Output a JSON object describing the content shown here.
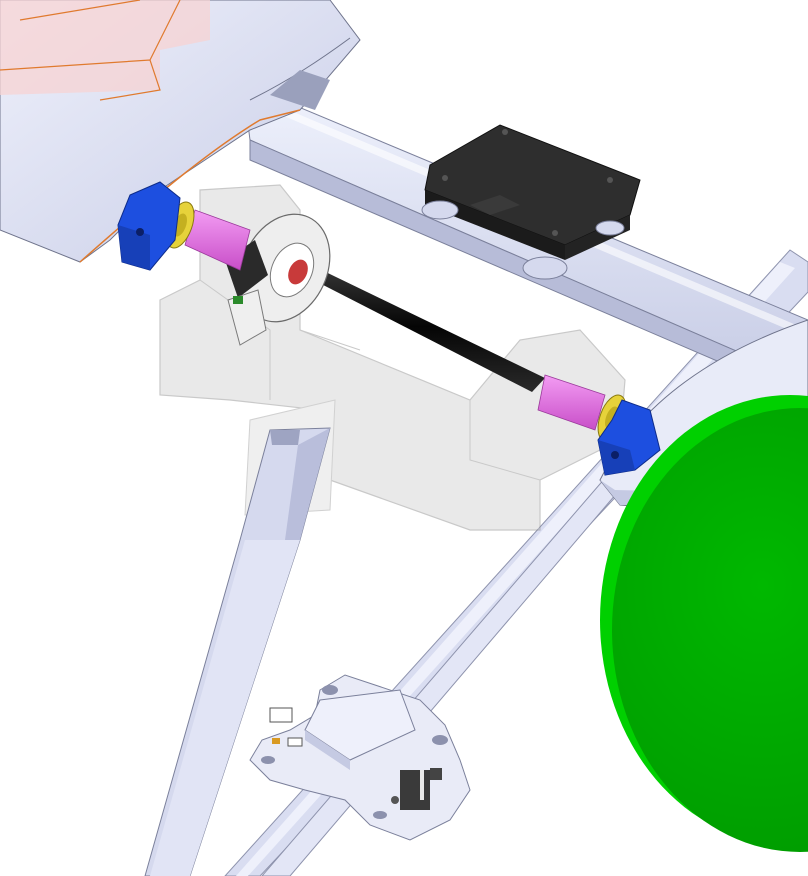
{
  "scene": {
    "background_color": "#ffffff",
    "palette": {
      "structure_light": "#e4e8f8",
      "structure_mid": "#c9cee6",
      "structure_dark": "#a9afcc",
      "outline": "#6f748c",
      "accent_orange": "#e07a2e",
      "wing_tint": "#f6c8c8",
      "clamp_blue": "#1d4fe0",
      "washer_yellow": "#e6d23a",
      "spacer_magenta": "#e070e0",
      "shaft_black": "#101010",
      "sensor_dark": "#2a2a2a",
      "transparent_housing": "#b8b8b8",
      "green_disc": "#00a800",
      "green_disc_edge": "#00d000",
      "flight_controller": "#2e2e2e"
    },
    "parts": [
      {
        "id": "left-wing-section",
        "icon": "wing-surface"
      },
      {
        "id": "cross-beam",
        "icon": "rectangular-tube"
      },
      {
        "id": "flight-controller-box",
        "icon": "enclosure"
      },
      {
        "id": "transparent-bearing-housing",
        "icon": "ghosted-solid"
      },
      {
        "id": "encoder-ring",
        "icon": "rotary-encoder"
      },
      {
        "id": "pivot-shaft",
        "icon": "rod"
      },
      {
        "id": "left-shaft-clamp",
        "icon": "clamp"
      },
      {
        "id": "right-shaft-clamp",
        "icon": "clamp"
      },
      {
        "id": "vertical-strut",
        "icon": "square-tube"
      },
      {
        "id": "diagonal-strut",
        "icon": "square-tube"
      },
      {
        "id": "sensor-board",
        "icon": "pcb"
      },
      {
        "id": "green-disc",
        "icon": "circle"
      }
    ]
  }
}
